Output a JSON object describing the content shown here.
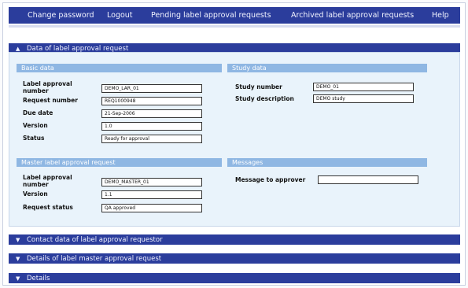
{
  "nav": {
    "items": [
      "Change password",
      "Logout",
      "Pending label approval requests",
      "Archived label approval requests",
      "Help"
    ]
  },
  "main_section": {
    "title": "Data of label approval request",
    "expanded": true
  },
  "basic_data": {
    "title": "Basic data",
    "fields": [
      {
        "label": "Label approval number",
        "value": "DEMO_LAR_01"
      },
      {
        "label": "Request number",
        "value": "REQ1000948"
      },
      {
        "label": "Due date",
        "value": "21-Sep-2006"
      },
      {
        "label": "Version",
        "value": "1.0"
      },
      {
        "label": "Status",
        "value": "Ready for approval"
      }
    ]
  },
  "study_data": {
    "title": "Study data",
    "fields": [
      {
        "label": "Study number",
        "value": "DEMO_01"
      },
      {
        "label": "Study description",
        "value": "DEMO study"
      }
    ]
  },
  "master_request": {
    "title": "Master label approval request",
    "fields": [
      {
        "label": "Label approval number",
        "value": "DEMO_MASTER_01"
      },
      {
        "label": "Version",
        "value": "1.1"
      },
      {
        "label": "Request status",
        "value": "QA approved"
      }
    ]
  },
  "messages": {
    "title": "Messages",
    "label": "Message to approver",
    "value": ""
  },
  "collapsed_sections": [
    {
      "title": "Contact data of label approval requestor"
    },
    {
      "title": "Details of label master approval request"
    },
    {
      "title": "Details"
    }
  ],
  "colors": {
    "header": "#2b3d9c",
    "subheader": "#8fb7e3",
    "panel": "#e9f3fb"
  },
  "icons": {
    "expanded": "chevron-up-icon",
    "collapsed": "chevron-down-icon"
  }
}
